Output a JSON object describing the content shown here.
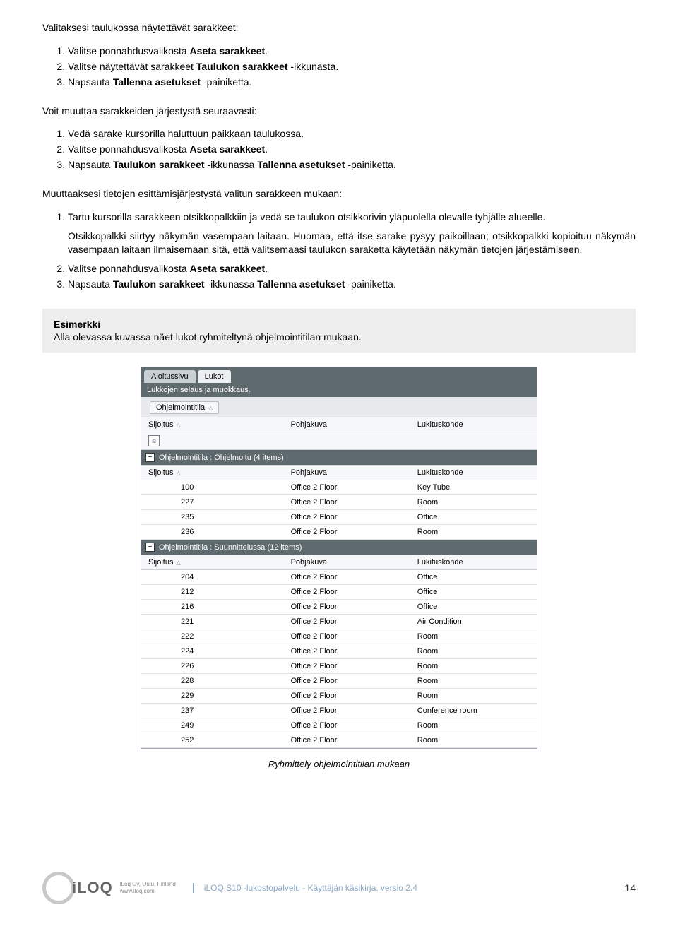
{
  "intro1": "Valitaksesi taulukossa näytettävät sarakkeet:",
  "steps1": [
    "Valitse ponnahdusvalikosta Aseta sarakkeet.",
    "Valitse näytettävät sarakkeet Taulukon sarakkeet -ikkunasta.",
    "Napsauta Tallenna asetukset -painiketta."
  ],
  "intro2": "Voit muuttaa sarakkeiden järjestystä seuraavasti:",
  "steps2": [
    "Vedä sarake kursorilla haluttuun paikkaan taulukossa.",
    "Valitse ponnahdusvalikosta Aseta sarakkeet.",
    "Napsauta Taulukon sarakkeet -ikkunassa Tallenna asetukset -painiketta."
  ],
  "intro3": "Muuttaaksesi tietojen esittämisjärjestystä valitun sarakkeen mukaan:",
  "steps3_1": "Tartu kursorilla sarakkeen otsikkopalkkiin ja vedä se taulukon otsikkorivin yläpuolella olevalle tyhjälle alueelle.",
  "steps3_para": "Otsikkopalkki siirtyy näkymän vasempaan laitaan. Huomaa, että itse sarake pysyy paikoillaan; otsikkopalkki kopioituu näkymän vasempaan laitaan ilmaisemaan sitä, että valitsemaasi taulukon saraketta käytetään näkymän tietojen järjestämiseen.",
  "steps3_2": "Valitse ponnahdusvalikosta Aseta sarakkeet.",
  "steps3_3": "Napsauta Taulukon sarakkeet -ikkunassa Tallenna asetukset -painiketta.",
  "example_title": "Esimerkki",
  "example_text": "Alla olevassa kuvassa näet lukot ryhmiteltynä ohjelmointitilan mukaan.",
  "app": {
    "tabs": [
      "Aloitussivu",
      "Lukot"
    ],
    "subbar": "Lukkojen selaus ja muokkaus.",
    "group_chip": "Ohjelmointitila",
    "columns": [
      "Sijoitus",
      "Pohjakuva",
      "Lukituskohde"
    ],
    "group1_header": "Ohjelmointitila : Ohjelmoitu (4 items)",
    "group1_rows": [
      {
        "c1": "100",
        "c2": "Office 2 Floor",
        "c3": "Key Tube"
      },
      {
        "c1": "227",
        "c2": "Office 2 Floor",
        "c3": "Room"
      },
      {
        "c1": "235",
        "c2": "Office 2 Floor",
        "c3": "Office"
      },
      {
        "c1": "236",
        "c2": "Office 2 Floor",
        "c3": "Room"
      }
    ],
    "group2_header": "Ohjelmointitila : Suunnittelussa (12 items)",
    "group2_rows": [
      {
        "c1": "204",
        "c2": "Office 2 Floor",
        "c3": "Office"
      },
      {
        "c1": "212",
        "c2": "Office 2 Floor",
        "c3": "Office"
      },
      {
        "c1": "216",
        "c2": "Office 2 Floor",
        "c3": "Office"
      },
      {
        "c1": "221",
        "c2": "Office 2 Floor",
        "c3": "Air Condition"
      },
      {
        "c1": "222",
        "c2": "Office 2 Floor",
        "c3": "Room"
      },
      {
        "c1": "224",
        "c2": "Office 2 Floor",
        "c3": "Room"
      },
      {
        "c1": "226",
        "c2": "Office 2 Floor",
        "c3": "Room"
      },
      {
        "c1": "228",
        "c2": "Office 2 Floor",
        "c3": "Room"
      },
      {
        "c1": "229",
        "c2": "Office 2 Floor",
        "c3": "Room"
      },
      {
        "c1": "237",
        "c2": "Office 2 Floor",
        "c3": "Conference room"
      },
      {
        "c1": "249",
        "c2": "Office 2 Floor",
        "c3": "Room"
      },
      {
        "c1": "252",
        "c2": "Office 2 Floor",
        "c3": "Room"
      }
    ]
  },
  "caption": "Ryhmittely ohjelmointitilan mukaan",
  "footer": {
    "brand": "iLOQ",
    "addr1": "iLoq Oy, Oulu, Finland",
    "addr2": "www.iloq.com",
    "doc": "iLOQ S10 -lukostopalvelu - Käyttäjän käsikirja, versio 2.4",
    "page": "14"
  }
}
